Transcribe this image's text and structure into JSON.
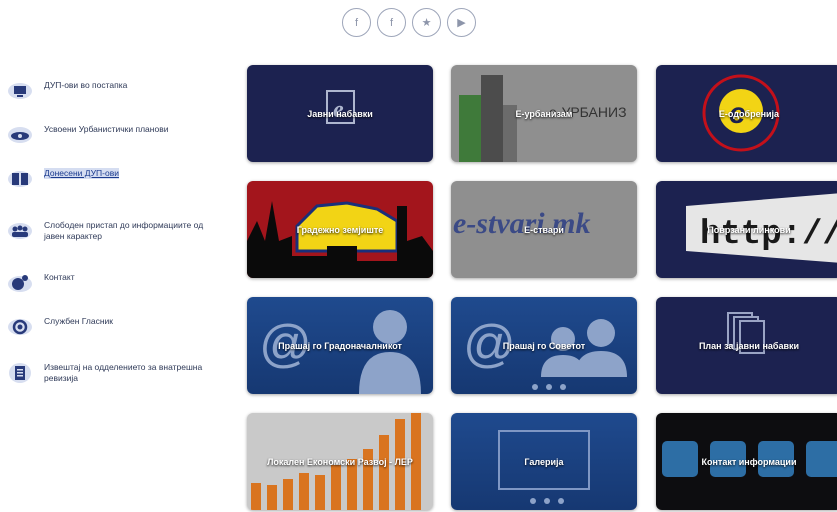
{
  "social": {
    "icons": [
      "facebook-icon",
      "facebook-icon",
      "twitter-icon",
      "youtube-icon"
    ],
    "glyphs": [
      "f",
      "f",
      "★",
      "▶"
    ]
  },
  "sidebar": {
    "items": [
      {
        "label": "ДУП-ови во постапка",
        "icon": "monitor-icon"
      },
      {
        "label": "Усвоени Урбанистички планови",
        "icon": "eye-icon"
      },
      {
        "label": "Донесени ДУП-ови",
        "icon": "book-icon",
        "active": true
      },
      {
        "label": "Слободен пристап до информациите од јавен карактер",
        "icon": "people-icon"
      },
      {
        "label": "Контакт",
        "icon": "contact-icon"
      },
      {
        "label": "Службен Гласник",
        "icon": "globe-icon"
      },
      {
        "label": "Извештај на одделението за внатрешна ревизија",
        "icon": "document-icon"
      }
    ]
  },
  "tiles": {
    "public_procurement": "Јавни набавки",
    "e_urbanism": "Е-урбанизам",
    "e_urbanism_logo": "е-УРБАНИЗ",
    "e_approvals": "Е-одобренија",
    "construction_land": "Градежно земјиште",
    "e_things": "Е-ствари",
    "e_things_logo": "e-stvari.mk",
    "useful_links": "Поврзани линкови",
    "useful_links_logo": "http://w",
    "ask_mayor": "Прашај го Градоначалникот",
    "ask_council": "Прашај го Советот",
    "procurement_plan": "План за јавни набавки",
    "led": "Локален Економски Развој - ЛЕР",
    "gallery": "Галерија",
    "contact_info": "Контакт информации"
  },
  "colors": {
    "navy": "#1c2250",
    "blue": "#1f4a8e",
    "gray": "#8f8f8f",
    "orange": "#d9741f",
    "yellow": "#f2d415",
    "red": "#c3101a"
  }
}
